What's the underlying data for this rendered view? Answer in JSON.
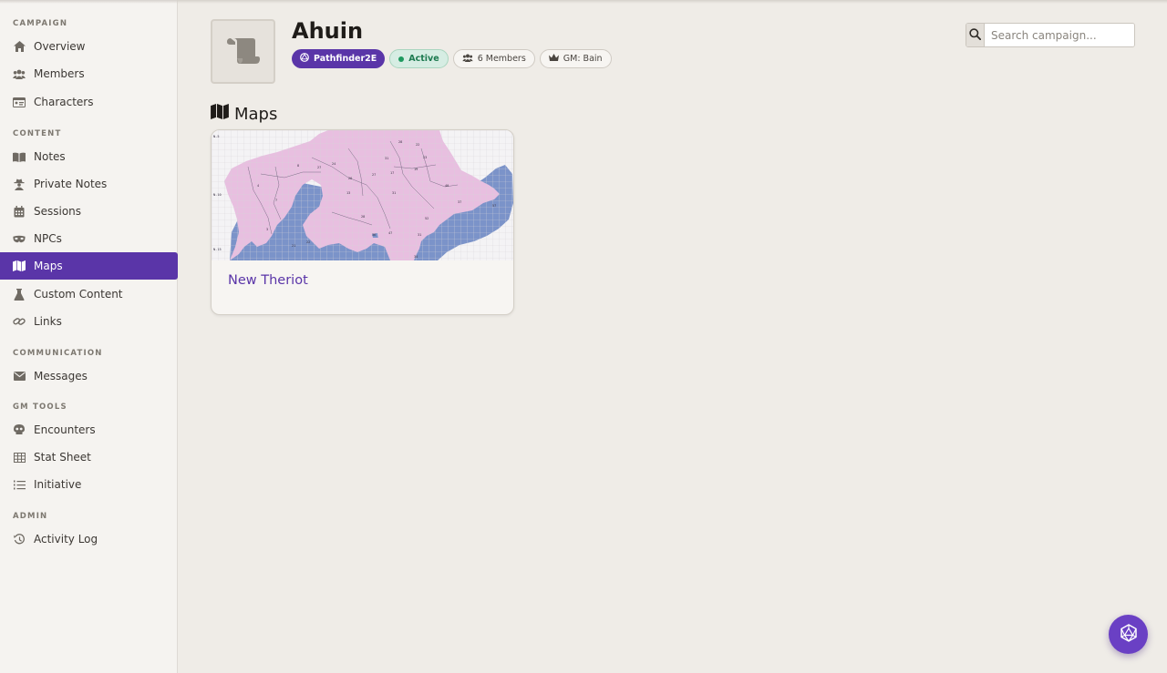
{
  "sidebar": {
    "sections": [
      {
        "title": "CAMPAIGN",
        "items": [
          {
            "label": "Overview",
            "icon": "home-icon"
          },
          {
            "label": "Members",
            "icon": "users-icon"
          },
          {
            "label": "Characters",
            "icon": "id-card-icon"
          }
        ]
      },
      {
        "title": "CONTENT",
        "items": [
          {
            "label": "Notes",
            "icon": "book-icon"
          },
          {
            "label": "Private Notes",
            "icon": "user-secret-icon"
          },
          {
            "label": "Sessions",
            "icon": "calendar-icon"
          },
          {
            "label": "NPCs",
            "icon": "mask-icon"
          },
          {
            "label": "Maps",
            "icon": "map-icon",
            "active": true
          },
          {
            "label": "Custom Content",
            "icon": "flask-icon"
          },
          {
            "label": "Links",
            "icon": "link-icon"
          }
        ]
      },
      {
        "title": "COMMUNICATION",
        "items": [
          {
            "label": "Messages",
            "icon": "envelope-icon"
          }
        ]
      },
      {
        "title": "GM TOOLS",
        "items": [
          {
            "label": "Encounters",
            "icon": "skull-icon"
          },
          {
            "label": "Stat Sheet",
            "icon": "table-icon"
          },
          {
            "label": "Initiative",
            "icon": "list-ordered-icon"
          }
        ]
      },
      {
        "title": "ADMIN",
        "items": [
          {
            "label": "Activity Log",
            "icon": "history-icon"
          }
        ]
      }
    ]
  },
  "campaign": {
    "title": "Ahuin",
    "icon": "scroll-icon",
    "badges": {
      "system": "Pathfinder2E",
      "status": "Active",
      "members": "6 Members",
      "gm": "GM: Bain"
    }
  },
  "search": {
    "placeholder": "Search campaign..."
  },
  "section": {
    "heading": "Maps",
    "icon": "map-icon"
  },
  "maps": [
    {
      "name": "New Theriot"
    }
  ],
  "colors": {
    "accent": "#5a35a8",
    "fab": "#6a40c4",
    "active_status": "#1e7a50",
    "background": "#efece7",
    "sidebar": "#f5f3f0",
    "map_land": "#e8bfe0",
    "map_water": "#7b93c9"
  },
  "fab": {
    "icon": "d20-icon"
  }
}
